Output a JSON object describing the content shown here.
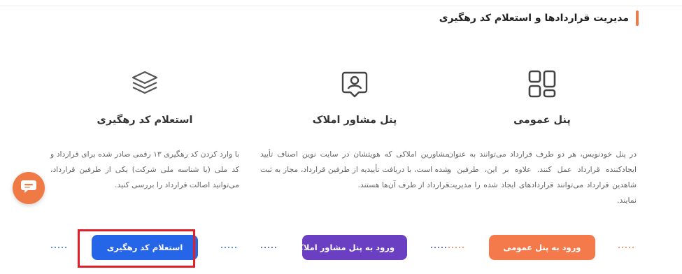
{
  "section": {
    "title": "مدیریت قراردادها و استعلام کد رهگیری",
    "accent_color": "#f07a45"
  },
  "cards": [
    {
      "id": "public",
      "icon": "grid-icon",
      "title": "پنل عمومی",
      "description": "در پنل خودنویس، هر دو طرف قرارداد می‌توانند به عنوان ایجادکننده قرارداد عمل کنند. علاوه بر این، طرفین و شاهدین قرارداد می‌توانند قراردادهای ایجاد شده را مدیریت نمایند.",
      "button_label": "ورود به پنل عمومی",
      "button_color": "#f47a4b",
      "dots_color": "#f07a45"
    },
    {
      "id": "advisor",
      "icon": "user-badge-icon",
      "title": "پنل مشاور املاک",
      "description": "مشاورین املاکی که هویتشان در سایت نوین اصناف تأیید شده است، با دریافت تأییدیه از طرفین قرارداد، مجاز به ثبت قرارداد از طرف آن‌ها هستند.",
      "button_label": "ورود به پنل مشاور املاک",
      "button_color": "#6a3fc2",
      "dots_color": "#3a4bb7"
    },
    {
      "id": "tracking",
      "icon": "layers-icon",
      "title": "استعلام کد رهگیری",
      "description": "با وارد کردن کد رهگیری ۱۳ رقمی صادر شده برای قرارداد و کد ملی (یا شناسه ملی شرکت) یکی از طرفین قرارداد، می‌توانید اصالت قرارداد را بررسی کنید.",
      "button_label": "استعلام کد رهگیری",
      "button_color": "#2566e8",
      "dots_color": "#2566e8"
    }
  ],
  "chat": {
    "icon": "chat-icon",
    "color": "#f07a45"
  },
  "highlight": {
    "color": "#e21f26"
  }
}
